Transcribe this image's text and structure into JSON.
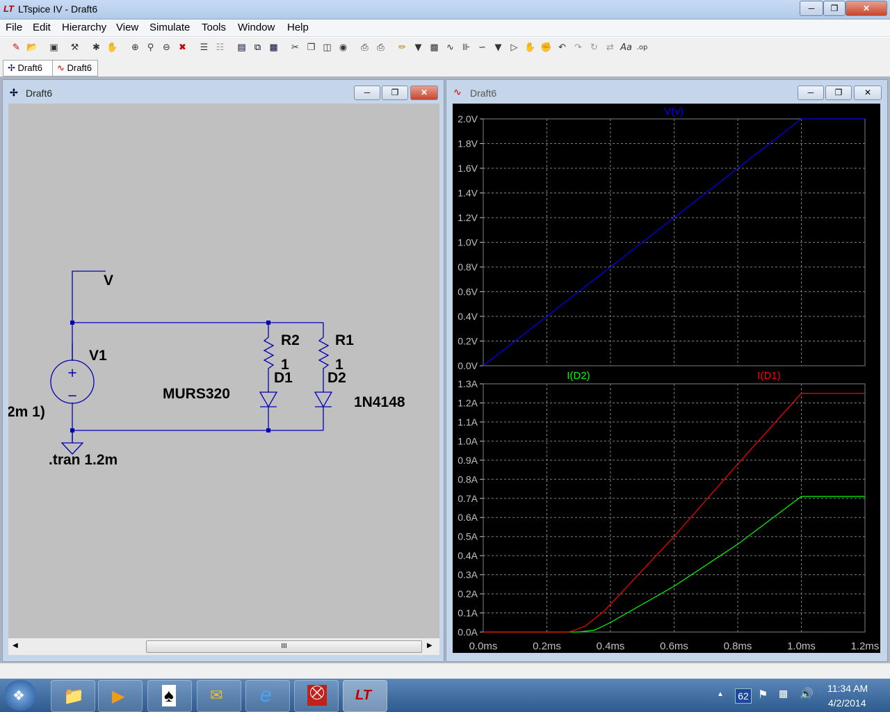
{
  "app": {
    "title": "LTspice IV - Draft6"
  },
  "menu": [
    "File",
    "Edit",
    "Hierarchy",
    "View",
    "Simulate",
    "Tools",
    "Window",
    "Help"
  ],
  "tabs": [
    {
      "label": "Draft6"
    },
    {
      "label": "Draft6"
    }
  ],
  "schematic": {
    "title": "Draft6",
    "labels": {
      "net_v": "V",
      "v1": "V1",
      "r2": "R2",
      "r2_val": "1",
      "r1": "R1",
      "r1_val": "1",
      "d1": "D1",
      "d2": "D2",
      "murs": "MURS320",
      "n4148": "1N4148",
      "pwl": "2m 1)",
      "tran": ".tran 1.2m"
    },
    "scroll_grip": "III"
  },
  "plotwin": {
    "title": "Draft6"
  },
  "chart_data": [
    {
      "type": "line",
      "title": "",
      "trace": "V(v)",
      "color": "#0000ff",
      "yticks": [
        "2.0V",
        "1.8V",
        "1.6V",
        "1.4V",
        "1.2V",
        "1.0V",
        "0.8V",
        "0.6V",
        "0.4V",
        "0.2V",
        "0.0V"
      ],
      "ylim": [
        0,
        2.0
      ],
      "xlim": [
        0,
        1.2
      ],
      "series": [
        {
          "name": "V(v)",
          "x": [
            0,
            1.0,
            1.2
          ],
          "y": [
            0,
            2.0,
            2.0
          ]
        }
      ]
    },
    {
      "type": "line",
      "title": "",
      "yticks": [
        "1.3A",
        "1.2A",
        "1.1A",
        "1.0A",
        "0.9A",
        "0.8A",
        "0.7A",
        "0.6A",
        "0.5A",
        "0.4A",
        "0.3A",
        "0.2A",
        "0.1A",
        "0.0A"
      ],
      "xticks": [
        "0.0ms",
        "0.2ms",
        "0.4ms",
        "0.6ms",
        "0.8ms",
        "1.0ms",
        "1.2ms"
      ],
      "ylim": [
        0,
        1.3
      ],
      "xlim": [
        0,
        1.2
      ],
      "series": [
        {
          "name": "I(D2)",
          "color": "#00ff00",
          "x": [
            0,
            0.3,
            0.35,
            0.4,
            0.6,
            0.8,
            1.0,
            1.2
          ],
          "y": [
            0,
            0,
            0.01,
            0.05,
            0.24,
            0.46,
            0.71,
            0.71
          ]
        },
        {
          "name": "I(D1)",
          "color": "#ff0000",
          "x": [
            0,
            0.27,
            0.32,
            0.38,
            0.6,
            0.8,
            1.0,
            1.2
          ],
          "y": [
            0,
            0,
            0.03,
            0.11,
            0.5,
            0.88,
            1.25,
            1.25
          ]
        }
      ]
    }
  ],
  "tray": {
    "badge": "62",
    "time": "11:34 AM",
    "date": "4/2/2014"
  }
}
